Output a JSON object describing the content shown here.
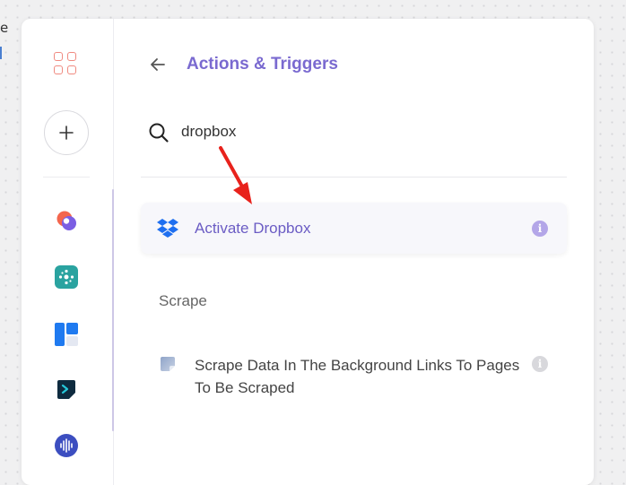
{
  "background": {
    "glyph": "e"
  },
  "header": {
    "title": "Actions & Triggers",
    "back_icon": "arrow-left-icon"
  },
  "search": {
    "value": "dropbox",
    "icon": "search-icon"
  },
  "results": [
    {
      "label": "Activate Dropbox",
      "icon": "dropbox-icon"
    }
  ],
  "sections": [
    {
      "title": "Scrape",
      "items": [
        {
          "label": "Scrape Data In The Background Links To Pages To Be Scraped",
          "icon": "scrape-icon"
        }
      ]
    }
  ],
  "sidebar": {
    "apps_icon": "apps-grid-icon",
    "add_icon": "plus-icon",
    "app_icons": [
      "app-1-icon",
      "app-2-icon",
      "app-3-icon",
      "app-4-icon",
      "app-5-icon"
    ]
  },
  "colors": {
    "accent": "#7a6ad0",
    "result_bg": "#f7f7fb",
    "dropbox_blue": "#1f6ff0",
    "annotation_red": "#e8221c",
    "apps_icon": "#f08a80"
  }
}
